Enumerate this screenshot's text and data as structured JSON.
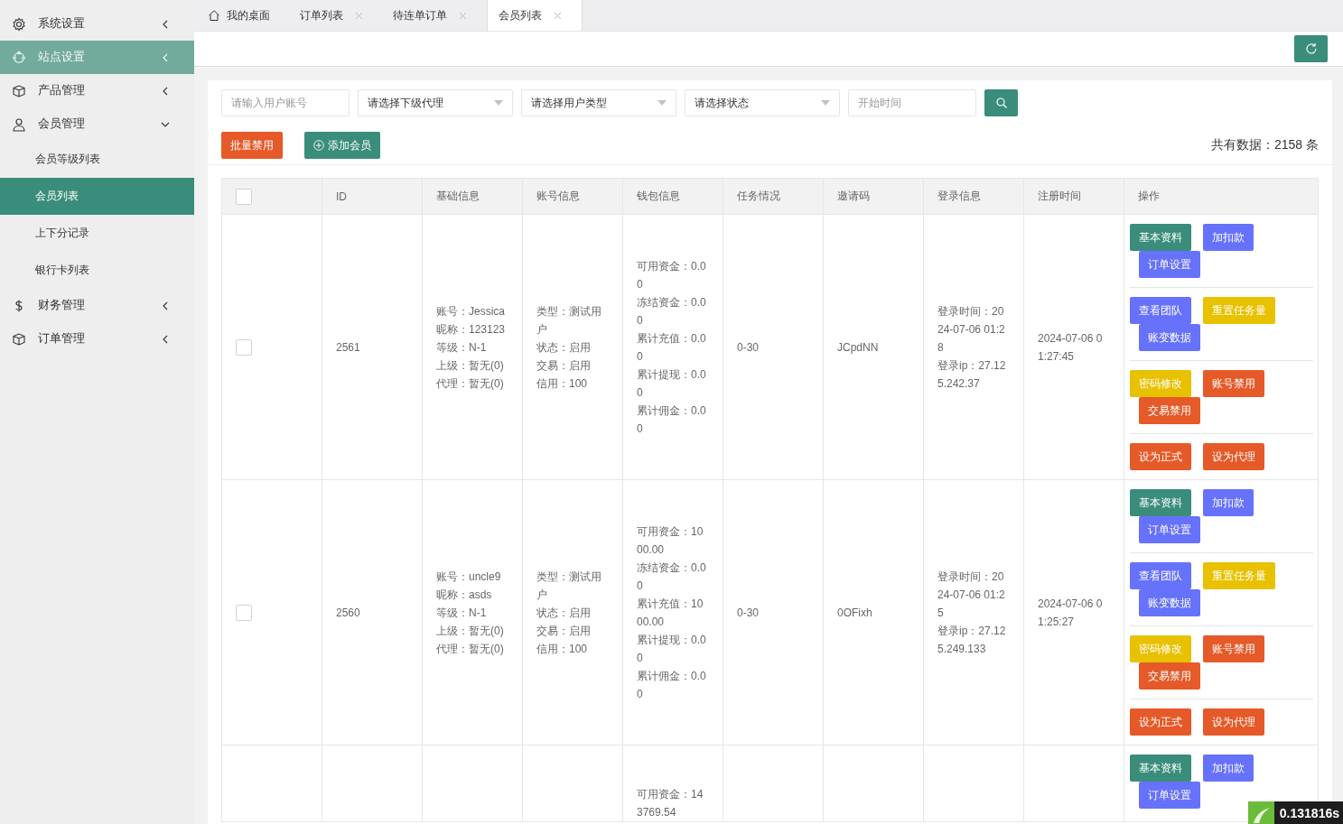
{
  "sidebar": {
    "items": [
      {
        "label": "系统设置",
        "hovered": false,
        "expanded": false
      },
      {
        "label": "站点设置",
        "hovered": true,
        "expanded": false
      },
      {
        "label": "产品管理",
        "hovered": false,
        "expanded": false
      },
      {
        "label": "会员管理",
        "hovered": false,
        "expanded": true,
        "children": [
          {
            "label": "会员等级列表",
            "selected": false
          },
          {
            "label": "会员列表",
            "selected": true
          },
          {
            "label": "上下分记录",
            "selected": false
          },
          {
            "label": "银行卡列表",
            "selected": false
          }
        ]
      },
      {
        "label": "财务管理",
        "hovered": false,
        "expanded": false
      },
      {
        "label": "订单管理",
        "hovered": false,
        "expanded": false
      }
    ]
  },
  "tabs": [
    {
      "label": "我的桌面",
      "closable": false,
      "selected": false
    },
    {
      "label": "订单列表",
      "closable": true,
      "selected": false
    },
    {
      "label": "待连单订单",
      "closable": true,
      "selected": false
    },
    {
      "label": "会员列表",
      "closable": true,
      "selected": true
    }
  ],
  "filters": [
    {
      "kind": "input",
      "placeholder": "请输入用户账号"
    },
    {
      "kind": "select",
      "value": "请选择下级代理"
    },
    {
      "kind": "select",
      "value": "请选择用户类型"
    },
    {
      "kind": "select",
      "value": "请选择状态"
    },
    {
      "kind": "input",
      "placeholder": "开始时间"
    }
  ],
  "toolbar": {
    "buttons": [
      {
        "label": "批量禁用",
        "color": "#e55a28"
      },
      {
        "label": "添加会员",
        "color": "#3a8d7a"
      }
    ],
    "total": "共有数据：2158 条"
  },
  "table": {
    "header_checked": false,
    "columns": [
      "ID",
      "基础信息",
      "账号信息",
      "钱包信息",
      "任务情况",
      "邀请码",
      "登录信息",
      "注册时间",
      "操作"
    ],
    "rows": [
      {
        "checked": false,
        "id": "2561",
        "basic": [
          "账号：Jessica",
          "昵称：123123",
          "等级：N-1",
          "上级：暂无(0)",
          "代理：暂无(0)"
        ],
        "account": [
          "类型：测试用户",
          "状态：启用",
          "交易：启用",
          "信用：100"
        ],
        "wallet": [
          "可用资金：0.00",
          "冻结资金：0.00",
          "累计充值：0.00",
          "累计提现：0.00",
          "累计佣金：0.00"
        ],
        "task": "0-30",
        "invite": "JCpdNN",
        "login": [
          "登录时间：2024-07-06 01:28",
          "登录ip：27.125.242.37"
        ],
        "registered": "2024-07-06 01:27:45",
        "actions": [
          [
            {
              "label": "基本资料",
              "color": "#3a8d7a"
            },
            {
              "label": "加扣款",
              "color": "#6672fb"
            },
            {
              "label": "订单设置",
              "color": "#6672fb"
            }
          ],
          [
            {
              "label": "查看团队",
              "color": "#6672fb"
            },
            {
              "label": "重置任务量",
              "color": "#e8c100"
            },
            {
              "label": "账变数据",
              "color": "#6672fb"
            }
          ],
          [
            {
              "label": "密码修改",
              "color": "#e8c100"
            },
            {
              "label": "账号禁用",
              "color": "#e55a28"
            },
            {
              "label": "交易禁用",
              "color": "#e55a28"
            }
          ],
          [
            {
              "label": "设为正式",
              "color": "#e55a28"
            },
            {
              "label": "设为代理",
              "color": "#e55a28"
            }
          ]
        ]
      },
      {
        "checked": false,
        "id": "2560",
        "basic": [
          "账号：uncle9",
          "昵称：asds",
          "等级：N-1",
          "上级：暂无(0)",
          "代理：暂无(0)"
        ],
        "account": [
          "类型：测试用户",
          "状态：启用",
          "交易：启用",
          "信用：100"
        ],
        "wallet": [
          "可用资金：1000.00",
          "冻结资金：0.00",
          "累计充值：1000.00",
          "累计提现：0.00",
          "累计佣金：0.00"
        ],
        "task": "0-30",
        "invite": "0OFixh",
        "login": [
          "登录时间：2024-07-06 01:25",
          "登录ip：27.125.249.133"
        ],
        "registered": "2024-07-06 01:25:27",
        "actions": [
          [
            {
              "label": "基本资料",
              "color": "#3a8d7a"
            },
            {
              "label": "加扣款",
              "color": "#6672fb"
            },
            {
              "label": "订单设置",
              "color": "#6672fb"
            }
          ],
          [
            {
              "label": "查看团队",
              "color": "#6672fb"
            },
            {
              "label": "重置任务量",
              "color": "#e8c100"
            },
            {
              "label": "账变数据",
              "color": "#6672fb"
            }
          ],
          [
            {
              "label": "密码修改",
              "color": "#e8c100"
            },
            {
              "label": "账号禁用",
              "color": "#e55a28"
            },
            {
              "label": "交易禁用",
              "color": "#e55a28"
            }
          ],
          [
            {
              "label": "设为正式",
              "color": "#e55a28"
            },
            {
              "label": "设为代理",
              "color": "#e55a28"
            }
          ]
        ]
      },
      {
        "wallet": [
          "可用资金：143769.54"
        ],
        "actions": [
          [
            {
              "label": "基本资料",
              "color": "#3a8d7a"
            },
            {
              "label": "加扣款",
              "color": "#6672fb"
            },
            {
              "label": "订单设置",
              "color": "#6672fb"
            }
          ]
        ]
      }
    ]
  },
  "timer": "0.131816s"
}
